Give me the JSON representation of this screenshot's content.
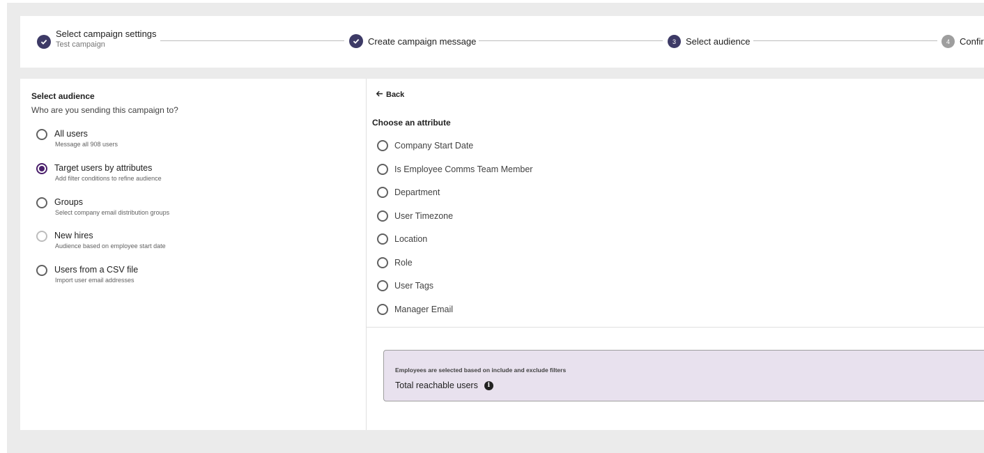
{
  "stepper": {
    "steps": [
      {
        "label": "Select campaign settings",
        "sub": "Test campaign",
        "state": "done"
      },
      {
        "label": "Create campaign message",
        "state": "done"
      },
      {
        "label": "Select audience",
        "number": "3",
        "state": "current"
      },
      {
        "label": "Confir",
        "number": "4",
        "state": "todo"
      }
    ]
  },
  "audience": {
    "title": "Select audience",
    "subtitle": "Who are you sending this campaign to?",
    "options": [
      {
        "label": "All users",
        "desc": "Message all 908 users",
        "checked": false
      },
      {
        "label": "Target users by attributes",
        "desc": "Add filter conditions to refine audience",
        "checked": true
      },
      {
        "label": "Groups",
        "desc": "Select company email distribution groups",
        "checked": false
      },
      {
        "label": "New hires",
        "desc": "Audience based on employee start date",
        "checked": false,
        "disabled": true
      },
      {
        "label": "Users from a CSV file",
        "desc": "Import user email addresses",
        "checked": false
      }
    ]
  },
  "attributes": {
    "back_label": "Back",
    "title": "Choose an attribute",
    "items": [
      "Company Start Date",
      "Is Employee Comms Team Member",
      "Department",
      "User Timezone",
      "Location",
      "Role",
      "User Tags",
      "Manager Email"
    ]
  },
  "reach": {
    "note": "Employees are selected based on include and exclude filters",
    "label": "Total reachable users",
    "info_icon": "info-icon"
  },
  "colors": {
    "step_done": "#3d3a66",
    "radio_selected": "#4a1f6b",
    "reach_box_bg": "#e8e1ee",
    "page_bg": "#ebebeb"
  }
}
